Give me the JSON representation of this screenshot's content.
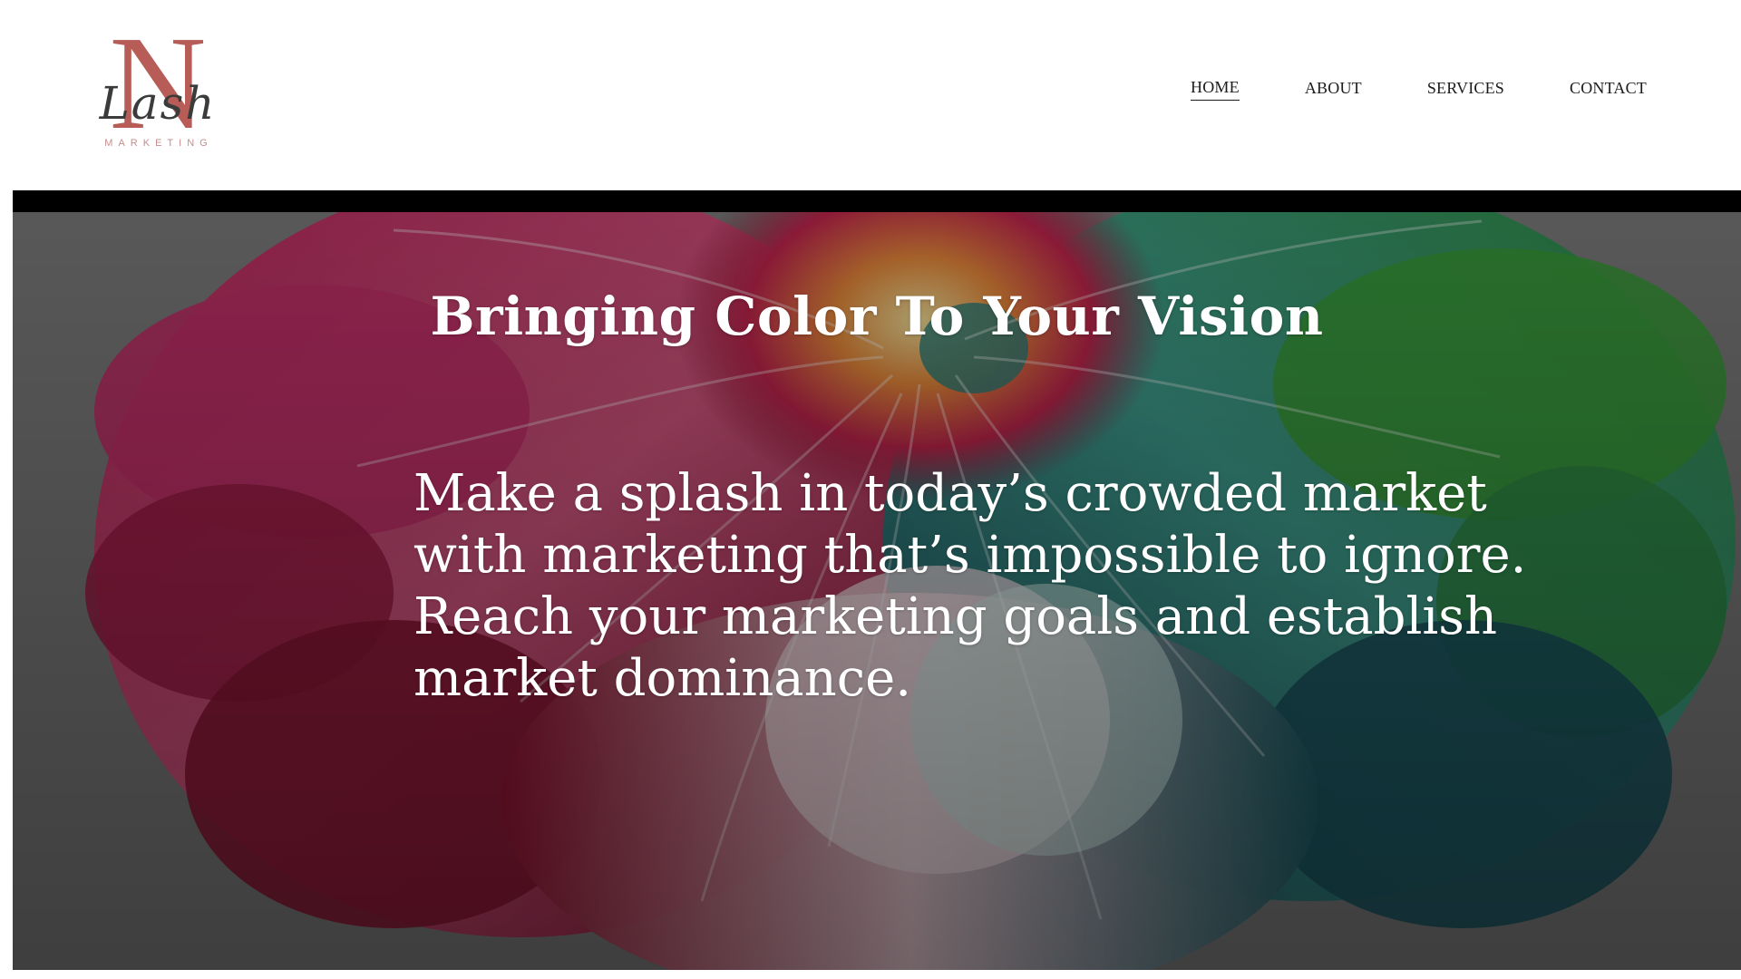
{
  "logo": {
    "letter": "N",
    "script": "Lash",
    "tagline": "MARKETING",
    "color": "#b85c57"
  },
  "nav": {
    "items": [
      {
        "label": "HOME",
        "active": true
      },
      {
        "label": "ABOUT",
        "active": false
      },
      {
        "label": "SERVICES",
        "active": false
      },
      {
        "label": "CONTACT",
        "active": false
      }
    ]
  },
  "hero": {
    "title": "Bringing Color To Your Vision",
    "body": "Make a splash in today’s crowded market with marketing that’s impossible to ignore. Reach your marketing goals and establish market dominance.",
    "overlay_color": "#7b7b7b"
  }
}
